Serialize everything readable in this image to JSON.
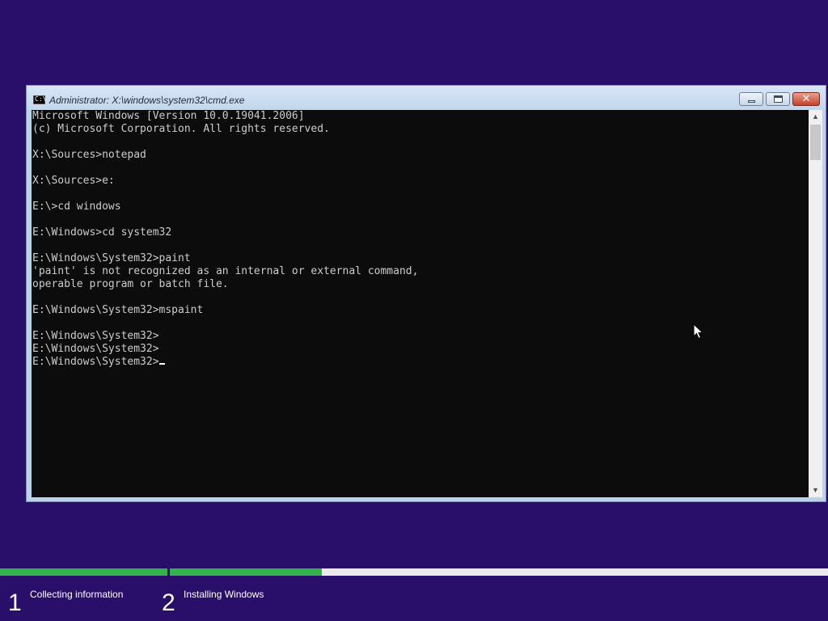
{
  "window": {
    "title": "Administrator: X:\\windows\\system32\\cmd.exe",
    "icon_text": "C:\\",
    "controls": {
      "minimize": "minimize-icon",
      "maximize": "maximize-icon",
      "close": "✕"
    }
  },
  "console": {
    "lines": [
      "Microsoft Windows [Version 10.0.19041.2006]",
      "(c) Microsoft Corporation. All rights reserved.",
      "",
      "X:\\Sources>notepad",
      "",
      "X:\\Sources>e:",
      "",
      "E:\\>cd windows",
      "",
      "E:\\Windows>cd system32",
      "",
      "E:\\Windows\\System32>paint",
      "'paint' is not recognized as an internal or external command,",
      "operable program or batch file.",
      "",
      "E:\\Windows\\System32>mspaint",
      "",
      "E:\\Windows\\System32>",
      "E:\\Windows\\System32>",
      "E:\\Windows\\System32>"
    ],
    "text_color": "#cccccc",
    "background": "#0c0c0c"
  },
  "scrollbar": {
    "up": "▲",
    "down": "▼"
  },
  "setup": {
    "progress_color": "#33b34a",
    "steps": [
      {
        "number": "1",
        "label": "Collecting information"
      },
      {
        "number": "2",
        "label": "Installing Windows"
      }
    ]
  },
  "colors": {
    "desktop": "#2a0f6a",
    "frame": "#bcd3ea"
  }
}
